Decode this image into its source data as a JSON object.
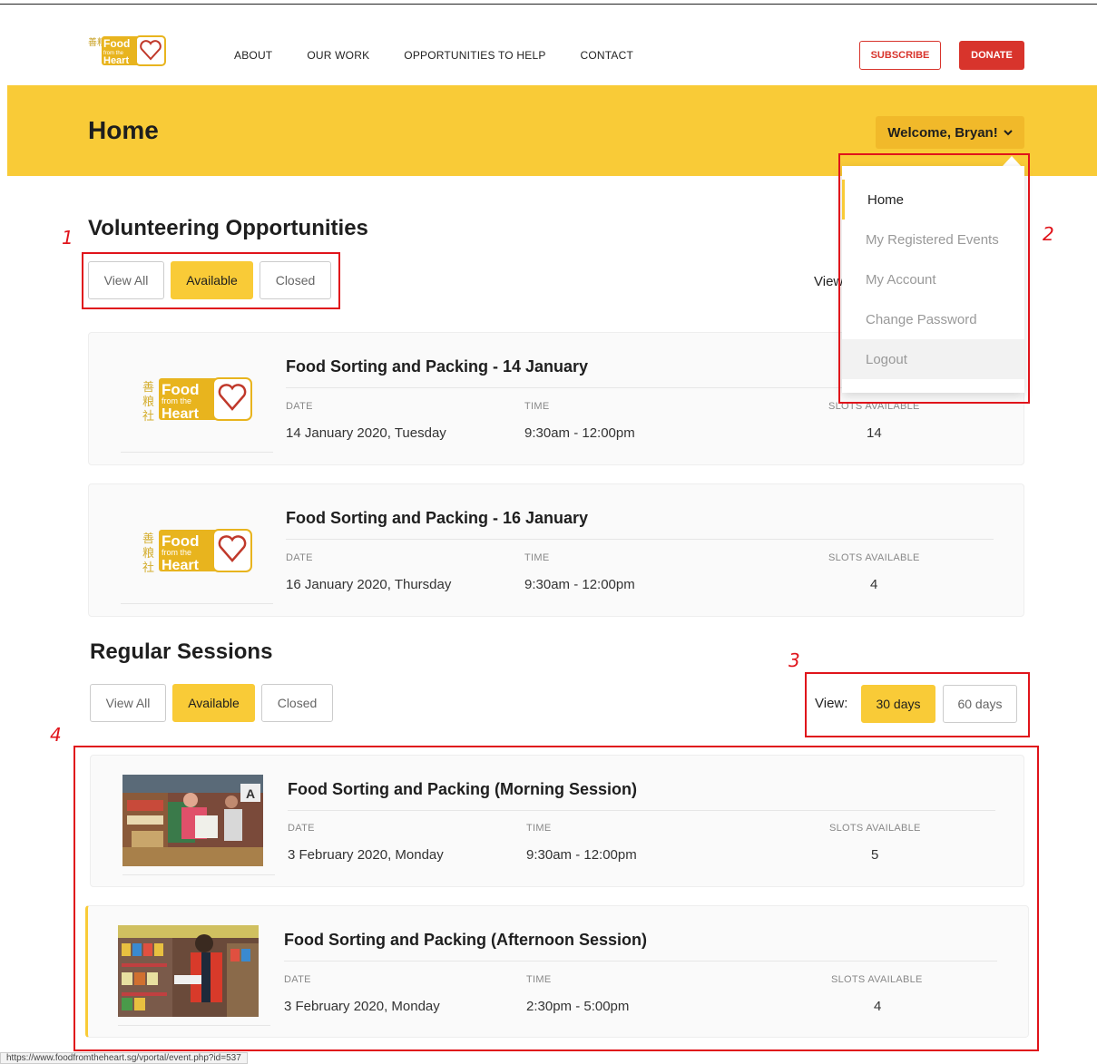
{
  "header": {
    "logo": {
      "chinese": "善粮社",
      "word1": "Food",
      "word2": "from the",
      "word3": "Heart"
    },
    "nav": [
      "ABOUT",
      "OUR WORK",
      "OPPORTUNITIES TO HELP",
      "CONTACT"
    ],
    "subscribe": "SUBSCRIBE",
    "donate": "DONATE"
  },
  "banner": {
    "title": "Home",
    "welcome": "Welcome, Bryan!"
  },
  "dropdown": {
    "items": [
      "Home",
      "My Registered Events",
      "My Account",
      "Change Password",
      "Logout"
    ]
  },
  "volunteering": {
    "title": "Volunteering Opportunities",
    "filters": [
      "View All",
      "Available",
      "Closed"
    ],
    "view_partial": "View",
    "events": [
      {
        "title": "Food Sorting and Packing - 14 January",
        "date_label": "DATE",
        "date": "14 January 2020, Tuesday",
        "time_label": "TIME",
        "time": "9:30am - 12:00pm",
        "slots_label": "SLOTS AVAILABLE",
        "slots": "14"
      },
      {
        "title": "Food Sorting and Packing - 16 January",
        "date_label": "DATE",
        "date": "16 January 2020, Thursday",
        "time_label": "TIME",
        "time": "9:30am - 12:00pm",
        "slots_label": "SLOTS AVAILABLE",
        "slots": "4"
      }
    ]
  },
  "regular": {
    "title": "Regular Sessions",
    "filters": [
      "View All",
      "Available",
      "Closed"
    ],
    "view_label": "View:",
    "view_options": [
      "30 days",
      "60 days"
    ],
    "sessions": [
      {
        "title": "Food Sorting and Packing (Morning Session)",
        "date_label": "DATE",
        "date": "3 February 2020, Monday",
        "time_label": "TIME",
        "time": "9:30am - 12:00pm",
        "slots_label": "SLOTS AVAILABLE",
        "slots": "5"
      },
      {
        "title": "Food Sorting and Packing (Afternoon Session)",
        "date_label": "DATE",
        "date": "3 February 2020, Monday",
        "time_label": "TIME",
        "time": "2:30pm - 5:00pm",
        "slots_label": "SLOTS AVAILABLE",
        "slots": "4"
      }
    ]
  },
  "annotations": [
    "1",
    "2",
    "3",
    "4"
  ],
  "status_url": "https://www.foodfromtheheart.sg/vportal/event.php?id=537",
  "colors": {
    "brand_yellow": "#f9cb37",
    "brand_red": "#d8342c",
    "annotation_red": "#e0141b"
  }
}
